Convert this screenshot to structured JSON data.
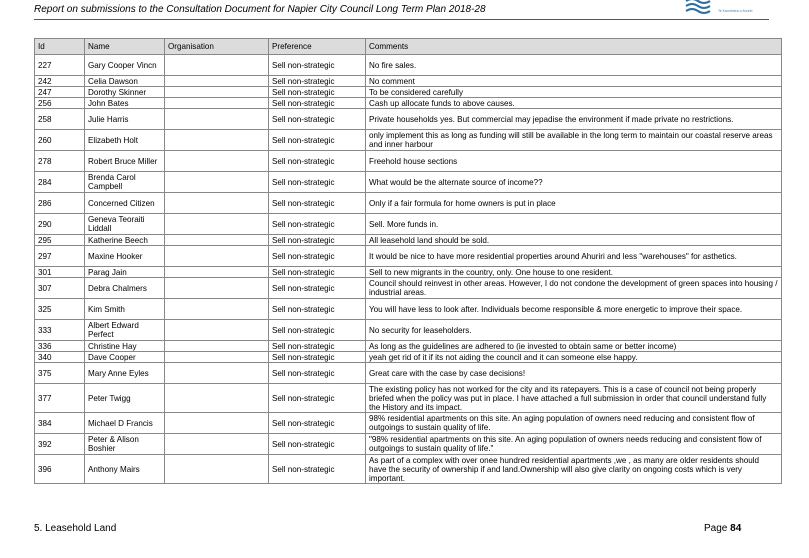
{
  "header": {
    "title": "Report on submissions to the Consultation Document for Napier City Council Long Term Plan 2018-28",
    "logo_subtext": "Te Kaunihera o Ahuriri"
  },
  "table": {
    "columns": [
      "Id",
      "Name",
      "Organisation",
      "Preference",
      "Comments"
    ],
    "rows": [
      {
        "id": "227",
        "name": "Gary Cooper Vincn",
        "org": "",
        "pref": "Sell non-strategic",
        "comment": "No fire sales."
      },
      {
        "id": "242",
        "name": "Celia Dawson",
        "org": "",
        "pref": "Sell non-strategic",
        "comment": "No comment"
      },
      {
        "id": "247",
        "name": "Dorothy Skinner",
        "org": "",
        "pref": "Sell non-strategic",
        "comment": "To be considered carefully"
      },
      {
        "id": "256",
        "name": "John Bates",
        "org": "",
        "pref": "Sell non-strategic",
        "comment": "Cash up allocate funds to above causes."
      },
      {
        "id": "258",
        "name": "Julie Harris",
        "org": "",
        "pref": "Sell non-strategic",
        "comment": "Private households yes. But commercial may jepadise the environment if made private no restrictions."
      },
      {
        "id": "260",
        "name": "Elizabeth Holt",
        "org": "",
        "pref": "Sell non-strategic",
        "comment": "only implement this as long as funding will still be available in the long term to maintain our coastal reserve areas and inner harbour"
      },
      {
        "id": "278",
        "name": "Robert Bruce Miller",
        "org": "",
        "pref": "Sell non-strategic",
        "comment": "Freehold house sections"
      },
      {
        "id": "284",
        "name": "Brenda Carol Campbell",
        "org": "",
        "pref": "Sell non-strategic",
        "comment": "What would be the alternate source of income??"
      },
      {
        "id": "286",
        "name": "Concerned Citizen",
        "org": "",
        "pref": "Sell non-strategic",
        "comment": "Only if a fair formula for home owners is put in place"
      },
      {
        "id": "290",
        "name": "Geneva Teoraiti Liddall",
        "org": "",
        "pref": "Sell non-strategic",
        "comment": "Sell. More funds in."
      },
      {
        "id": "295",
        "name": "Katherine Beech",
        "org": "",
        "pref": "Sell non-strategic",
        "comment": "All leasehold land should be sold."
      },
      {
        "id": "297",
        "name": "Maxine Hooker",
        "org": "",
        "pref": "Sell non-strategic",
        "comment": "It would be nice to have more residential properties around Ahuriri and less \"warehouses\" for asthetics."
      },
      {
        "id": "301",
        "name": "Parag Jain",
        "org": "",
        "pref": "Sell non-strategic",
        "comment": "Sell to new migrants in the country, only. One house to one resident."
      },
      {
        "id": "307",
        "name": "Debra Chalmers",
        "org": "",
        "pref": "Sell non-strategic",
        "comment": "Council should reinvest in other areas. However, I do not condone the development of green spaces into housing / industrial areas."
      },
      {
        "id": "325",
        "name": "Kim Smith",
        "org": "",
        "pref": "Sell non-strategic",
        "comment": "You will have less to look after. Individuals become responsible & more energetic to improve their space."
      },
      {
        "id": "333",
        "name": "Albert Edward Perfect",
        "org": "",
        "pref": "Sell non-strategic",
        "comment": "No security for leaseholders."
      },
      {
        "id": "336",
        "name": "Christine Hay",
        "org": "",
        "pref": "Sell non-strategic",
        "comment": "As long as the guidelines are adhered to (ie invested to obtain same or better income)"
      },
      {
        "id": "340",
        "name": "Dave Cooper",
        "org": "",
        "pref": "Sell non-strategic",
        "comment": "yeah get rid of it if its not aiding the council and it can someone else happy."
      },
      {
        "id": "375",
        "name": "Mary Anne Eyles",
        "org": "",
        "pref": "Sell non-strategic",
        "comment": "Great care with the case by case decisions!"
      },
      {
        "id": "377",
        "name": "Peter Twigg",
        "org": "",
        "pref": "Sell non-strategic",
        "comment": "The existing policy has not worked for the city and its ratepayers. This is a case of council not being properly briefed when the policy was put in place. I have attached a full submission in order that council understand fully the History and its impact."
      },
      {
        "id": "384",
        "name": "Michael D Francis",
        "org": "",
        "pref": "Sell non-strategic",
        "comment": "98% residential apartments on this site. An aging population of owners need reducing and consistent  flow of outgoings to sustain quality of life."
      },
      {
        "id": "392",
        "name": "Peter & Alison Boshier",
        "org": "",
        "pref": "Sell non-strategic",
        "comment": "\"98% residential apartments on this site. An aging population of owners needs reducing and consistent flow of outgoings to sustain quality of life.\""
      },
      {
        "id": "396",
        "name": "Anthony Mairs",
        "org": "",
        "pref": "Sell non-strategic",
        "comment": "As part of a complex with over onee hundred residential apartments ,we , as many are older residents should have the security of ownership if and land.Ownership will also give clarity on ongoing costs which is very important."
      }
    ]
  },
  "footer": {
    "section": "5. Leasehold Land",
    "page_label": "Page",
    "page_number": "84"
  }
}
